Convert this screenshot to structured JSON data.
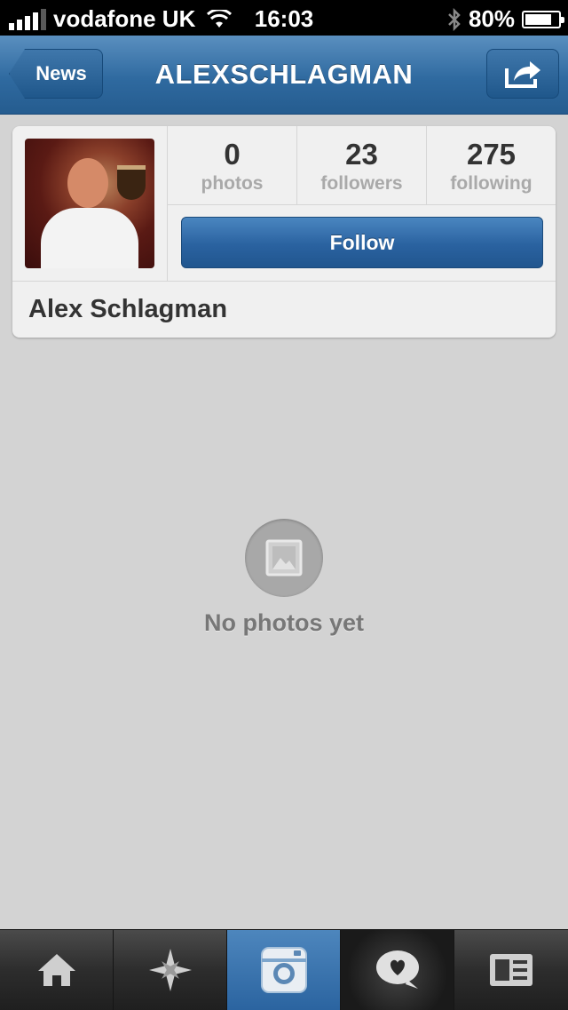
{
  "status_bar": {
    "carrier": "vodafone UK",
    "time": "16:03",
    "battery_percent": "80%",
    "battery_level": 0.8
  },
  "nav": {
    "back_label": "News",
    "title": "ALEXSCHLAGMAN"
  },
  "profile": {
    "stats": [
      {
        "value": "0",
        "label": "photos"
      },
      {
        "value": "23",
        "label": "followers"
      },
      {
        "value": "275",
        "label": "following"
      }
    ],
    "follow_label": "Follow",
    "full_name": "Alex Schlagman"
  },
  "empty_state": {
    "text": "No photos yet"
  },
  "tab_bar": {
    "tabs": [
      "home-icon",
      "explore-icon",
      "camera-icon",
      "news-icon",
      "profile-icon"
    ],
    "active": "camera-icon"
  },
  "colors": {
    "nav_blue": "#2f6aa0",
    "follow_blue": "#2a62a0",
    "background": "#d3d3d3"
  }
}
